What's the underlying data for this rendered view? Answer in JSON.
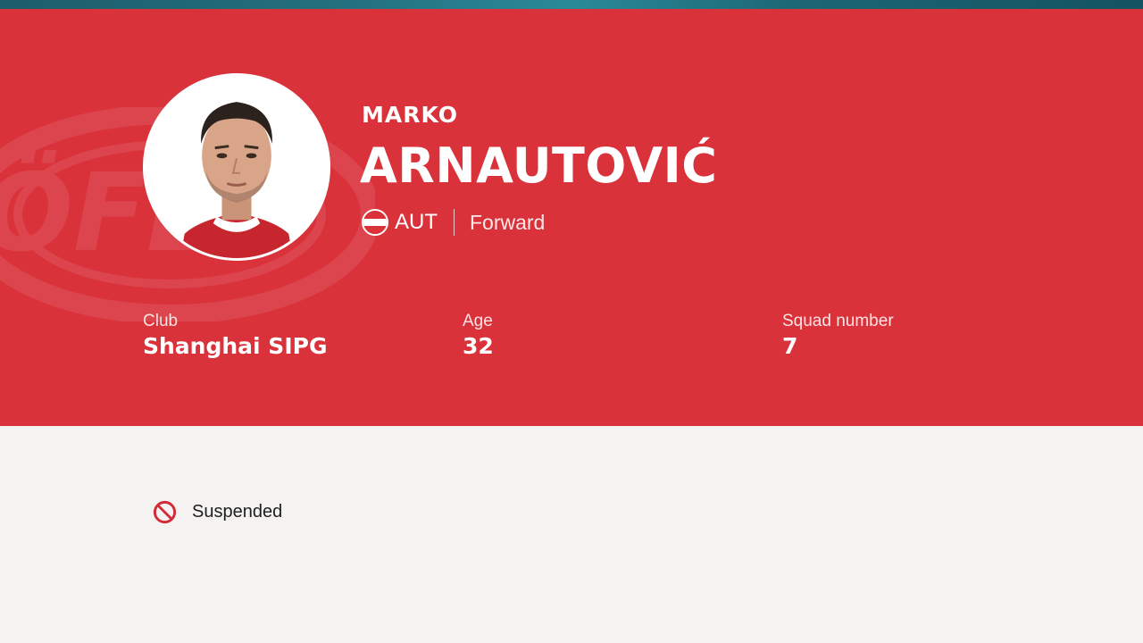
{
  "colors": {
    "hero_background": "#d9323b",
    "page_background": "#f4f3f1",
    "status_icon": "#d42a35"
  },
  "player": {
    "first_name": "MARKO",
    "last_name": "ARNAUTOVIĆ",
    "nation_code": "AUT",
    "flag_icon": "austria-flag-icon",
    "position": "Forward"
  },
  "stats": {
    "club": {
      "label": "Club",
      "value": "Shanghai SIPG"
    },
    "age": {
      "label": "Age",
      "value": "32"
    },
    "squad_number": {
      "label": "Squad number",
      "value": "7"
    }
  },
  "status": {
    "icon": "prohibited-icon",
    "text": "Suspended"
  }
}
